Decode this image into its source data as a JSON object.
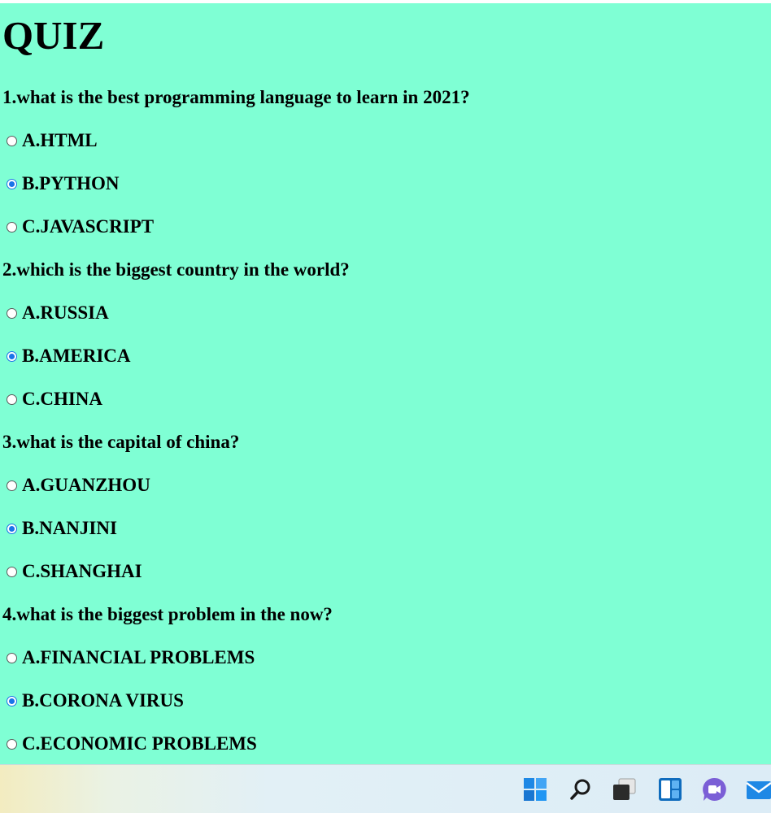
{
  "title": "QUIZ",
  "questions": [
    {
      "text": "1.what is the best programming language to learn in 2021?",
      "options": [
        {
          "label": "A.HTML",
          "checked": false
        },
        {
          "label": "B.PYTHON",
          "checked": true
        },
        {
          "label": "C.JAVASCRIPT",
          "checked": false
        }
      ]
    },
    {
      "text": "2.which is the biggest country in the world?",
      "options": [
        {
          "label": "A.RUSSIA",
          "checked": false
        },
        {
          "label": "B.AMERICA",
          "checked": true
        },
        {
          "label": "C.CHINA",
          "checked": false
        }
      ]
    },
    {
      "text": "3.what is the capital of china?",
      "options": [
        {
          "label": "A.GUANZHOU",
          "checked": false
        },
        {
          "label": "B.NANJINI",
          "checked": true
        },
        {
          "label": "C.SHANGHAI",
          "checked": false
        }
      ]
    },
    {
      "text": "4.what is the biggest problem in the now?",
      "options": [
        {
          "label": "A.FINANCIAL PROBLEMS",
          "checked": false
        },
        {
          "label": "B.CORONA VIRUS",
          "checked": true
        },
        {
          "label": "C.ECONOMIC PROBLEMS",
          "checked": false
        }
      ]
    }
  ],
  "colors": {
    "page_background": "#7fffd4",
    "radio_accent": "#1a73e8"
  },
  "taskbar": {
    "icons": [
      "windows-start-icon",
      "search-icon",
      "task-view-icon",
      "widgets-icon",
      "teams-chat-icon",
      "mail-icon"
    ]
  }
}
